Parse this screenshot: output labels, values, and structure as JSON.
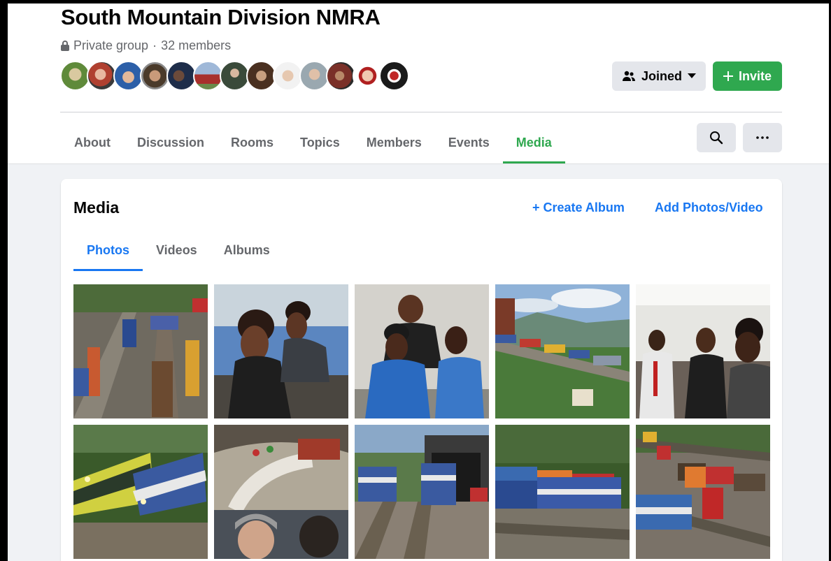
{
  "group": {
    "name": "South Mountain Division NMRA",
    "privacy": "Private group",
    "separator": "·",
    "members": "32 members"
  },
  "header": {
    "joined_label": "Joined",
    "invite_label": "Invite",
    "joined_icon": "people-icon",
    "invite_icon": "plus-icon"
  },
  "tabs": [
    {
      "label": "About"
    },
    {
      "label": "Discussion"
    },
    {
      "label": "Rooms"
    },
    {
      "label": "Topics"
    },
    {
      "label": "Members"
    },
    {
      "label": "Events"
    },
    {
      "label": "Media"
    }
  ],
  "active_tab": "Media",
  "media": {
    "title": "Media",
    "create_album": "Create Album",
    "add_photos": "Add Photos/Video",
    "subtabs": [
      {
        "label": "Photos"
      },
      {
        "label": "Videos"
      },
      {
        "label": "Albums"
      }
    ],
    "active_subtab": "Photos"
  },
  "colors": {
    "accent_green": "#2fa84f",
    "link_blue": "#1877f2",
    "muted_text": "#65676b",
    "button_grey": "#e4e6eb"
  }
}
